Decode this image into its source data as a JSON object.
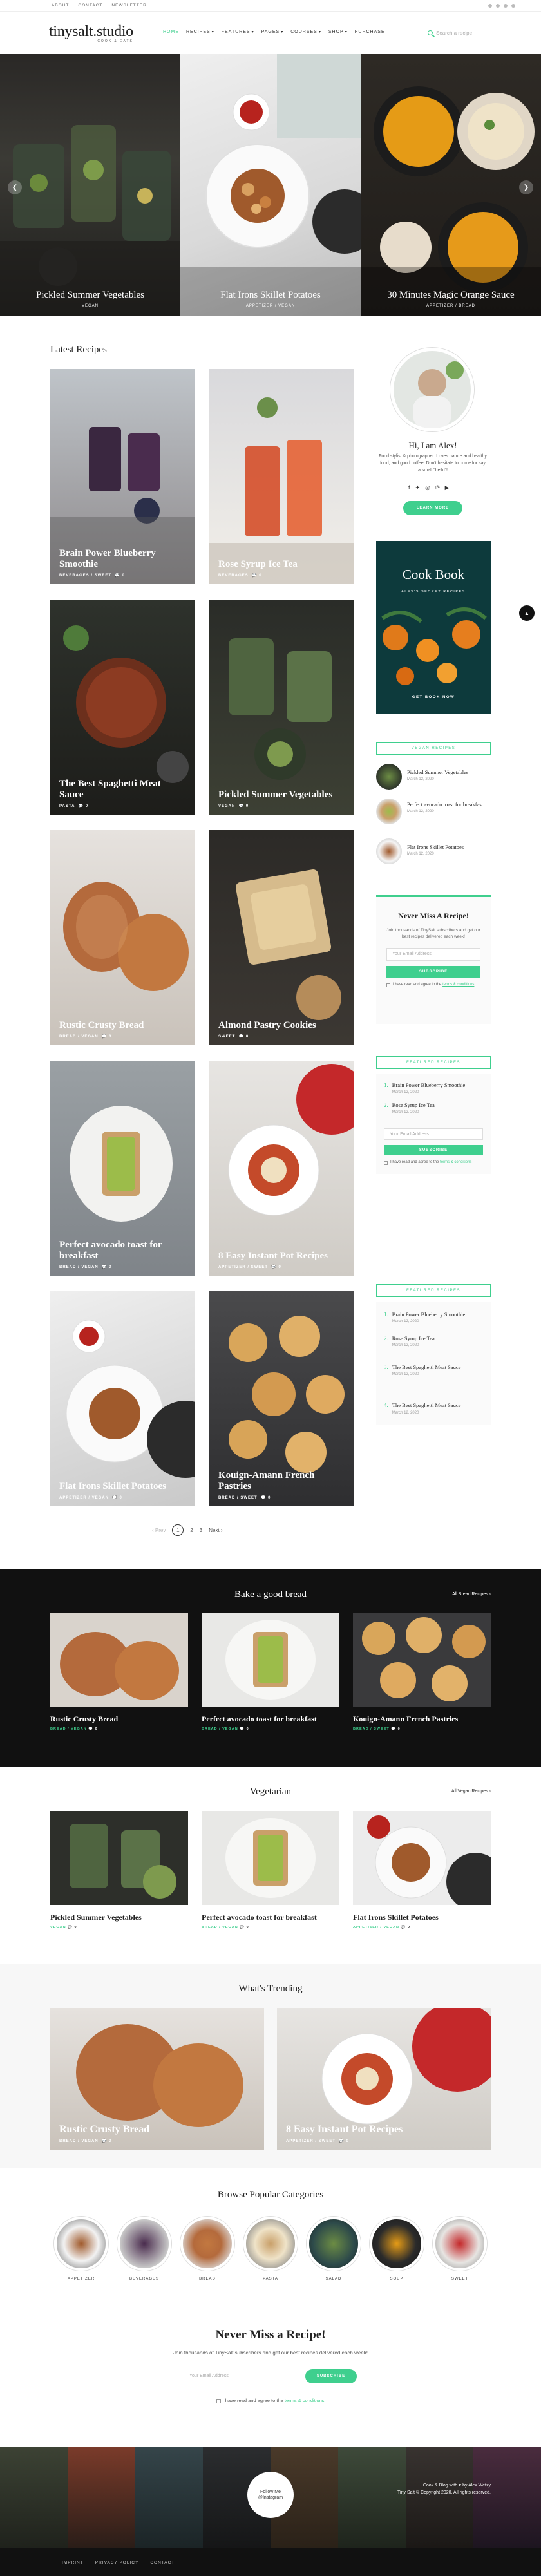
{
  "topbar": {
    "links": [
      "About",
      "Contact",
      "Newsletter"
    ]
  },
  "header": {
    "logo": "tinysalt.studio",
    "tagline": "COOK & EATS",
    "nav": [
      {
        "label": "Home",
        "active": true
      },
      {
        "label": "Recipes",
        "dropdown": true
      },
      {
        "label": "Features",
        "dropdown": true
      },
      {
        "label": "Pages",
        "dropdown": true
      },
      {
        "label": "Courses",
        "dropdown": true
      },
      {
        "label": "Shop",
        "dropdown": true
      },
      {
        "label": "Purchase"
      }
    ],
    "search_placeholder": "Search a recipe"
  },
  "hero": {
    "slides": [
      {
        "title": "Pickled Summer Vegetables",
        "category": "VEGAN"
      },
      {
        "title": "Flat Irons Skillet Potatoes",
        "category": "APPETIZER / VEGAN"
      },
      {
        "title": "30 Minutes Magic Orange Sauce",
        "category": "APPETIZER / BREAD"
      }
    ]
  },
  "latest": {
    "title": "Latest Recipes",
    "cards": [
      {
        "title": "Brain Power Blueberry Smoothie",
        "meta": "BEVERAGES / SWEET",
        "count": "0"
      },
      {
        "title": "Rose Syrup Ice Tea",
        "meta": "BEVERAGES",
        "count": "0"
      },
      {
        "title": "The Best Spaghetti Meat Sauce",
        "meta": "PASTA",
        "count": "0"
      },
      {
        "title": "Pickled Summer Vegetables",
        "meta": "VEGAN",
        "count": "0"
      },
      {
        "title": "Rustic Crusty Bread",
        "meta": "BREAD / VEGAN",
        "count": "0"
      },
      {
        "title": "Almond Pastry Cookies",
        "meta": "SWEET",
        "count": "0"
      },
      {
        "title": "Perfect avocado toast for breakfast",
        "meta": "BREAD / VEGAN",
        "count": "0"
      },
      {
        "title": "8 Easy Instant Pot Recipes",
        "meta": "APPETIZER / SWEET",
        "count": "0"
      },
      {
        "title": "Flat Irons Skillet Potatoes",
        "meta": "APPETIZER / VEGAN",
        "count": "0"
      },
      {
        "title": "Kouign-Amann French Pastries",
        "meta": "BREAD / SWEET",
        "count": "0"
      }
    ],
    "pagination": {
      "prev": "Prev",
      "pages": [
        "1",
        "2",
        "3"
      ],
      "next": "Next"
    }
  },
  "sidebar": {
    "about": {
      "greeting": "Hi, I am Alex!",
      "text": "Food stylist & photographer. Loves nature and healthy food, and good coffee. Don't hesitate to come for say a small \"hello\"!",
      "button": "LEARN MORE"
    },
    "book": {
      "title": "Cook Book",
      "subtitle": "ALEX'S SECRET RECIPES",
      "button": "GET BOOK NOW"
    },
    "vegan": {
      "title": "Vegan Recipes",
      "items": [
        {
          "title": "Pickled Summer Vegetables",
          "date": "March 12, 2020"
        },
        {
          "title": "Perfect avocado toast for breakfast",
          "date": "March 12, 2020"
        },
        {
          "title": "Flat Irons Skillet Potatoes",
          "date": "March 12, 2020"
        }
      ]
    },
    "newsletter": {
      "title": "Never Miss A Recipe!",
      "text": "Join thousands of TinySalt subscribers and get our best recipes delivered each week!",
      "placeholder": "Your Email Address",
      "button": "SUBSCRIBE",
      "consent": "I have read and agree to the",
      "terms": "terms & conditions"
    },
    "featured1": {
      "title": "Featured Recipes",
      "items": [
        {
          "n": "1.",
          "title": "Brain Power Blueberry Smoothie",
          "date": "March 12, 2020"
        },
        {
          "n": "2.",
          "title": "Rose Syrup Ice Tea",
          "date": "March 12, 2020"
        }
      ],
      "placeholder": "Your Email Address",
      "button": "SUBSCRIBE",
      "consent": "I have read and agree to the",
      "terms": "terms & conditions"
    },
    "featured2": {
      "title": "Featured Recipes",
      "items": [
        {
          "n": "1.",
          "title": "Brain Power Blueberry Smoothie",
          "date": "March 12, 2020"
        },
        {
          "n": "2.",
          "title": "Rose Syrup Ice Tea",
          "date": "March 12, 2020"
        },
        {
          "n": "3.",
          "title": "The Best Spaghetti Meat Sauce",
          "date": "March 12, 2020"
        },
        {
          "n": "4.",
          "title": "The Best Spaghetti Meat Sauce",
          "date": "March 12, 2020"
        }
      ]
    }
  },
  "bread": {
    "title": "Bake a good bread",
    "link": "All Bread Recipes",
    "items": [
      {
        "title": "Rustic Crusty Bread",
        "meta": "BREAD / VEGAN",
        "count": "0"
      },
      {
        "title": "Perfect avocado toast for breakfast",
        "meta": "BREAD / VEGAN",
        "count": "0"
      },
      {
        "title": "Kouign-Amann French Pastries",
        "meta": "BREAD / SWEET",
        "count": "0"
      }
    ]
  },
  "vegetarian": {
    "title": "Vegetarian",
    "link": "All Vegan Recipes",
    "items": [
      {
        "title": "Pickled Summer Vegetables",
        "meta": "VEGAN",
        "count": "0"
      },
      {
        "title": "Perfect avocado toast for breakfast",
        "meta": "BREAD / VEGAN",
        "count": "0"
      },
      {
        "title": "Flat Irons Skillet Potatoes",
        "meta": "APPETIZER / VEGAN",
        "count": "0"
      }
    ]
  },
  "trending": {
    "title": "What's Trending",
    "items": [
      {
        "title": "Rustic Crusty Bread",
        "meta": "BREAD / VEGAN",
        "count": "0"
      },
      {
        "title": "8 Easy Instant Pot Recipes",
        "meta": "APPETIZER / SWEET",
        "count": "0"
      }
    ]
  },
  "categories": {
    "title": "Browse Popular Categories",
    "items": [
      "Appetizer",
      "Beverages",
      "Bread",
      "Pasta",
      "Salad",
      "Soup",
      "Sweet"
    ]
  },
  "newsletter": {
    "title": "Never Miss a Recipe!",
    "text": "Join thousands of TinySalt subscribers and get our best recipes delivered each week!",
    "placeholder": "Your Email Address",
    "button": "SUBSCRIBE",
    "consent": "I have read and agree to the",
    "terms": "terms & conditions"
  },
  "instagram": {
    "follow": "Follow Me",
    "handle": "@Instagram"
  },
  "footer": {
    "links": [
      "Imprint",
      "Privacy Policy",
      "Contact"
    ],
    "credit": "Cook & Blog with ♥ by Alex Wetzy",
    "copyright": "Tiny Salt © Copyright 2020. All rights reserved."
  },
  "colors": {
    "accent": "#3fcf8e",
    "dark": "#111111"
  }
}
